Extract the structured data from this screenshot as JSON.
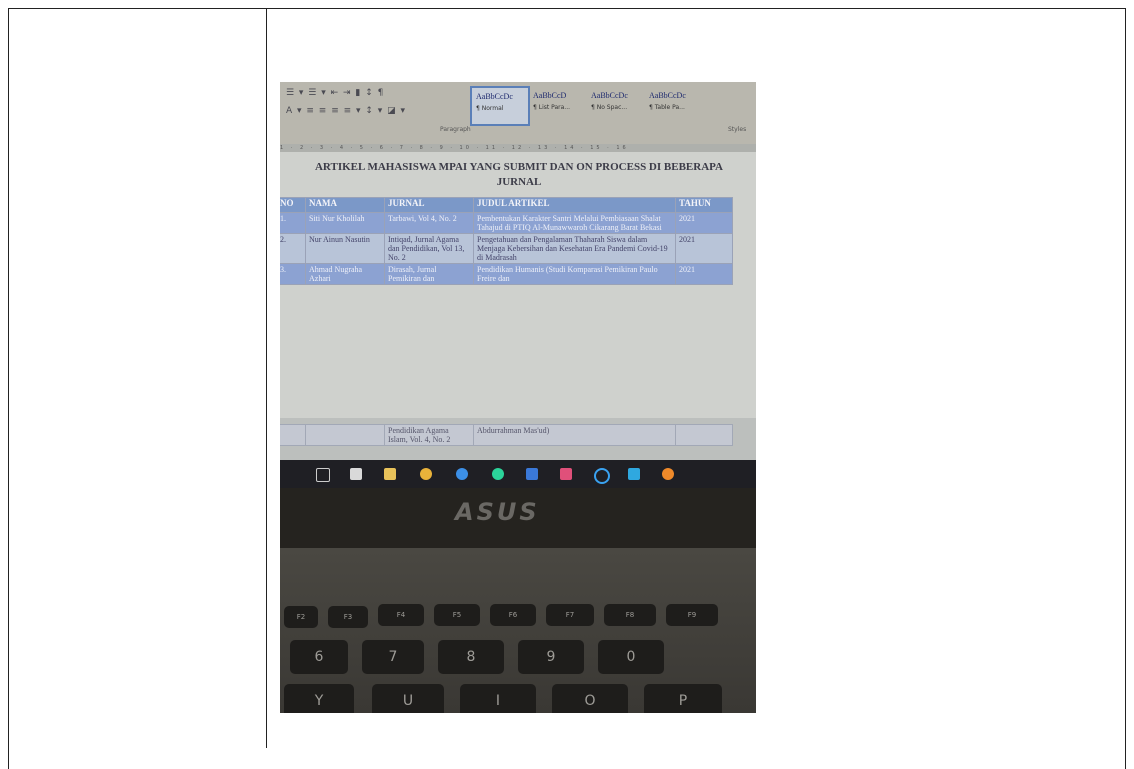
{
  "ribbon": {
    "paragraph_label": "Paragraph",
    "styles_label": "Styles",
    "styles": [
      {
        "sample": "AaBbCcDc",
        "name": "¶ Normal",
        "selected": true
      },
      {
        "sample": "AaBbCcD",
        "name": "¶ List Para...",
        "selected": false
      },
      {
        "sample": "AaBbCcDc",
        "name": "¶ No Spac...",
        "selected": false
      },
      {
        "sample": "AaBbCcDc",
        "name": "¶ Table Pa...",
        "selected": false
      }
    ],
    "ruler": "1 · 2 · 3 · 4 · 5 · 6 · 7 · 8 · 9 · 10 · 11 · 12 · 13 · 14 · 15 · 16"
  },
  "document": {
    "title_line1": "ARTIKEL MAHASISWA MPAI YANG SUBMIT DAN ON PROCESS DI BEBERAPA",
    "title_line2": "JURNAL",
    "headers": {
      "no": "NO",
      "nama": "NAMA",
      "jurnal": "JURNAL",
      "judul": "JUDUL ARTIKEL",
      "tahun": "TAHUN"
    },
    "rows": [
      {
        "no": "1.",
        "nama": "Siti Nur Kholilah",
        "jurnal": "Tarbawi, Vol 4, No. 2",
        "judul": "Pembentukan Karakter Santri Melalui Pembiasaan Shalat Tahajud di PTIQ Al-Munawwaroh Cikarang Barat Bekasi",
        "tahun": "2021"
      },
      {
        "no": "2.",
        "nama": "Nur Ainun Nasutin",
        "jurnal": "Intiqad, Jurnal Agama dan Pendidikan, Vol 13, No. 2",
        "judul": "Pengetahuan dan Pengalaman Thaharah Siswa dalam Menjaga Kebersihan dan Kesehatan Era Pandemi Covid-19 di Madrasah",
        "tahun": "2021"
      },
      {
        "no": "3.",
        "nama": "Ahmad Nugraha Azhari",
        "jurnal": "Dirasah, Jurnal Pemikiran dan",
        "judul": "Pendidikan Humanis (Studi Komparasi Pemikiran Paulo Freire dan",
        "tahun": "2021"
      }
    ],
    "continued_row": {
      "jurnal": "Pendidikan Agama Islam, Vol. 4, No. 2",
      "judul": "Abdurrahman Mas'ud)"
    }
  },
  "laptop": {
    "brand": "ASUS",
    "keys_top": [
      "F2",
      "F3",
      "F4",
      "F5",
      "F6",
      "F7",
      "F8",
      "F9"
    ],
    "keys_number": [
      "6",
      "7",
      "8",
      "9",
      "0"
    ],
    "keys_letter": [
      "Y",
      "U",
      "I",
      "O",
      "P"
    ]
  },
  "colors": {
    "table_header": "#7b98c8",
    "taskbar": "#1f1f24",
    "border": "#222222"
  }
}
